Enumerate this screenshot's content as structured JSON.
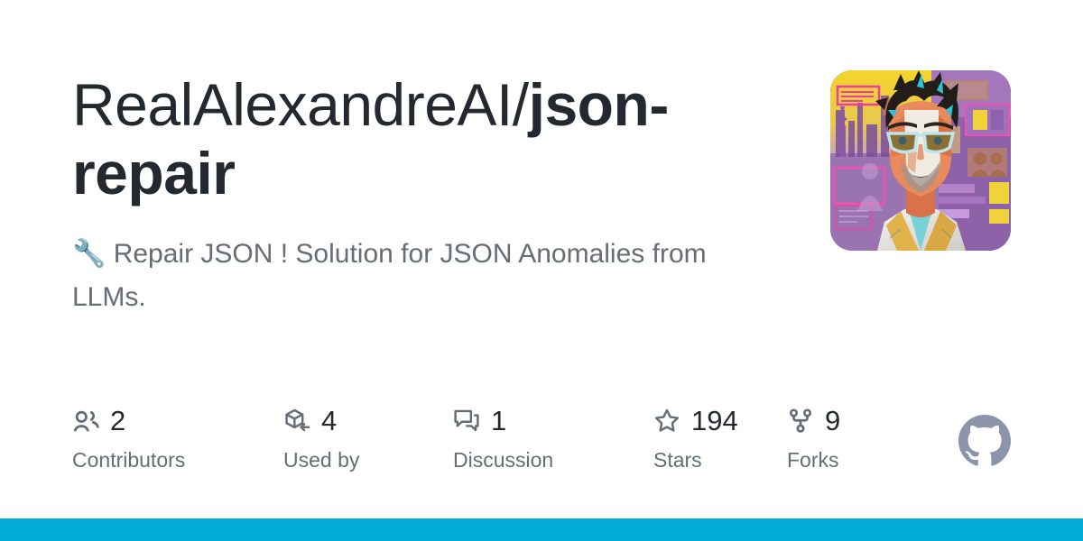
{
  "repository": {
    "owner": "RealAlexandreAI",
    "separator": "/",
    "name": "json-repair",
    "description_emoji": "🔧",
    "description": "Repair JSON ! Solution for JSON Anomalies from LLMs.",
    "avatar_alt": "cyberpunk-comic-portrait-avatar"
  },
  "stats": [
    {
      "icon": "people-icon",
      "value": "2",
      "label": "Contributors"
    },
    {
      "icon": "package-used-by-icon",
      "value": "4",
      "label": "Used by"
    },
    {
      "icon": "comment-discussion-icon",
      "value": "1",
      "label": "Discussion"
    },
    {
      "icon": "star-icon",
      "value": "194",
      "label": "Stars"
    },
    {
      "icon": "repo-forked-icon",
      "value": "9",
      "label": "Forks"
    }
  ],
  "branding": {
    "mark": "github-octocat-icon",
    "mark_color": "#8b94a8"
  },
  "colors": {
    "background": "#ffffff",
    "title_text": "#24292f",
    "muted_text": "#656d76",
    "accent_bar": "#00acd7"
  }
}
